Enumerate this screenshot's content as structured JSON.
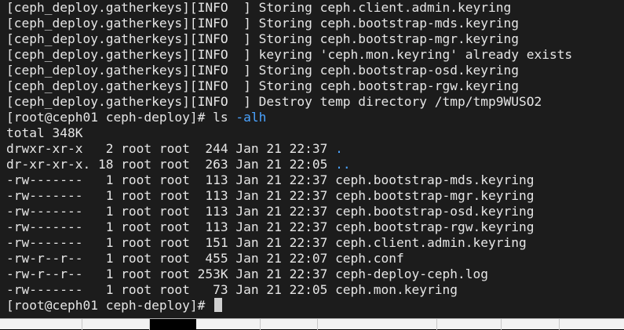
{
  "terminal": {
    "lines": [
      {
        "text": "[ceph_deploy.gatherkeys][INFO  ] Storing ceph.client.admin.keyring"
      },
      {
        "text": "[ceph_deploy.gatherkeys][INFO  ] Storing ceph.bootstrap-mds.keyring"
      },
      {
        "text": "[ceph_deploy.gatherkeys][INFO  ] Storing ceph.bootstrap-mgr.keyring"
      },
      {
        "text": "[ceph_deploy.gatherkeys][INFO  ] keyring 'ceph.mon.keyring' already exists"
      },
      {
        "text": "[ceph_deploy.gatherkeys][INFO  ] Storing ceph.bootstrap-osd.keyring"
      },
      {
        "text": "[ceph_deploy.gatherkeys][INFO  ] Storing ceph.bootstrap-rgw.keyring"
      },
      {
        "text": "[ceph_deploy.gatherkeys][INFO  ] Destroy temp directory /tmp/tmp9WUSO2"
      },
      {
        "prompt": "[root@ceph01 ceph-deploy]# ls ",
        "arg": "-alh"
      },
      {
        "text": "total 348K"
      },
      {
        "prefix": "drwxr-xr-x   2 root root  244 Jan 21 22:37 ",
        "name": "."
      },
      {
        "prefix": "dr-xr-xr-x. 18 root root  263 Jan 21 22:05 ",
        "name": ".."
      },
      {
        "text": "-rw-------   1 root root  113 Jan 21 22:37 ceph.bootstrap-mds.keyring"
      },
      {
        "text": "-rw-------   1 root root  113 Jan 21 22:37 ceph.bootstrap-mgr.keyring"
      },
      {
        "text": "-rw-------   1 root root  113 Jan 21 22:37 ceph.bootstrap-osd.keyring"
      },
      {
        "text": "-rw-------   1 root root  113 Jan 21 22:37 ceph.bootstrap-rgw.keyring"
      },
      {
        "text": "-rw-------   1 root root  151 Jan 21 22:37 ceph.client.admin.keyring"
      },
      {
        "text": "-rw-r--r--   1 root root  455 Jan 21 22:07 ceph.conf"
      },
      {
        "text": "-rw-r--r--   1 root root 253K Jan 21 22:37 ceph-deploy-ceph.log"
      },
      {
        "text": "-rw-------   1 root root   73 Jan 21 22:05 ceph.mon.keyring"
      }
    ],
    "final_prompt": "[root@ceph01 ceph-deploy]# "
  },
  "colors": {
    "background": "#1c1c1c",
    "foreground": "#e6e6e6",
    "highlight": "#4aa3ff"
  }
}
